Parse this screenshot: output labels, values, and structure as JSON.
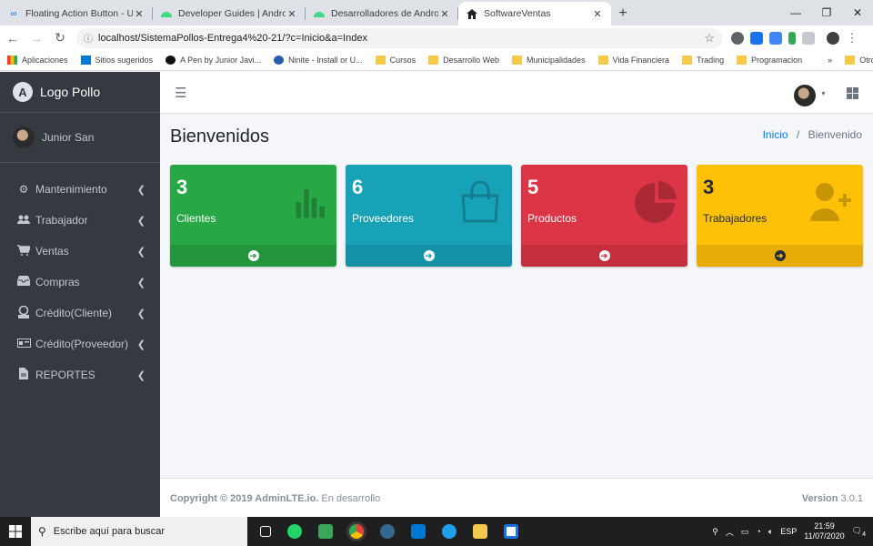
{
  "browser": {
    "tabs": [
      {
        "title": "Floating Action Button - Universi",
        "icon": "infinity-icon",
        "active": false
      },
      {
        "title": "Developer Guides | Android Dev",
        "icon": "android-icon",
        "active": false
      },
      {
        "title": "Desarrolladores de Android | An",
        "icon": "android-icon",
        "active": false
      },
      {
        "title": "SoftwareVentas",
        "icon": "home-icon",
        "active": true
      }
    ],
    "url": "localhost/SistemaPollos-Entrega4%20-21/?c=Inicio&a=Index",
    "bookmarks": [
      {
        "label": "Aplicaciones",
        "icon": "apps-icon"
      },
      {
        "label": "Sitios sugeridos",
        "icon": "bing-icon"
      },
      {
        "label": "A Pen by Junior Javi...",
        "icon": "codepen-icon"
      },
      {
        "label": "Ninite - Install or U...",
        "icon": "ninite-icon"
      },
      {
        "label": "Cursos",
        "icon": "folder-icon"
      },
      {
        "label": "Desarrollo Web",
        "icon": "folder-icon"
      },
      {
        "label": "Municipalidades",
        "icon": "folder-icon"
      },
      {
        "label": "Vida Financiera",
        "icon": "folder-icon"
      },
      {
        "label": "Trading",
        "icon": "folder-icon"
      },
      {
        "label": "Programacion",
        "icon": "folder-icon"
      }
    ],
    "bookmarks_more": "»",
    "other_favorites": "Otros favoritos"
  },
  "sidebar": {
    "brand": "Logo Pollo",
    "brand_letter": "A",
    "user": "Junior San",
    "items": [
      {
        "label": "Mantenimiento",
        "icon": "cogs-icon"
      },
      {
        "label": "Trabajador",
        "icon": "users-icon"
      },
      {
        "label": "Ventas",
        "icon": "cart-icon"
      },
      {
        "label": "Compras",
        "icon": "inbox-icon"
      },
      {
        "label": "Crédito(Cliente)",
        "icon": "coin-icon"
      },
      {
        "label": "Crédito(Proveedor)",
        "icon": "money-icon"
      },
      {
        "label": "REPORTES",
        "icon": "file-icon"
      }
    ]
  },
  "header": {
    "title": "Bienvenidos",
    "breadcrumb_home": "Inicio",
    "breadcrumb_sep": "/",
    "breadcrumb_current": "Bienvenido"
  },
  "cards": [
    {
      "count": "3",
      "label": "Clientes",
      "color": "#28a745",
      "icon": "bar-chart-icon"
    },
    {
      "count": "6",
      "label": "Proveedores",
      "color": "#17a2b8",
      "icon": "shopping-bag-icon"
    },
    {
      "count": "5",
      "label": "Productos",
      "color": "#dc3545",
      "icon": "pie-chart-icon"
    },
    {
      "count": "3",
      "label": "Trabajadores",
      "color": "#ffc107",
      "icon": "user-plus-icon"
    }
  ],
  "footer": {
    "copyright": "Copyright © 2019 AdminLTE.io.",
    "status": "En desarrollo",
    "version_label": "Version",
    "version": "3.0.1"
  },
  "taskbar": {
    "search_placeholder": "Escribe aquí para buscar",
    "language": "ESP",
    "time": "21:59",
    "date": "11/07/2020",
    "notifications": "4"
  }
}
